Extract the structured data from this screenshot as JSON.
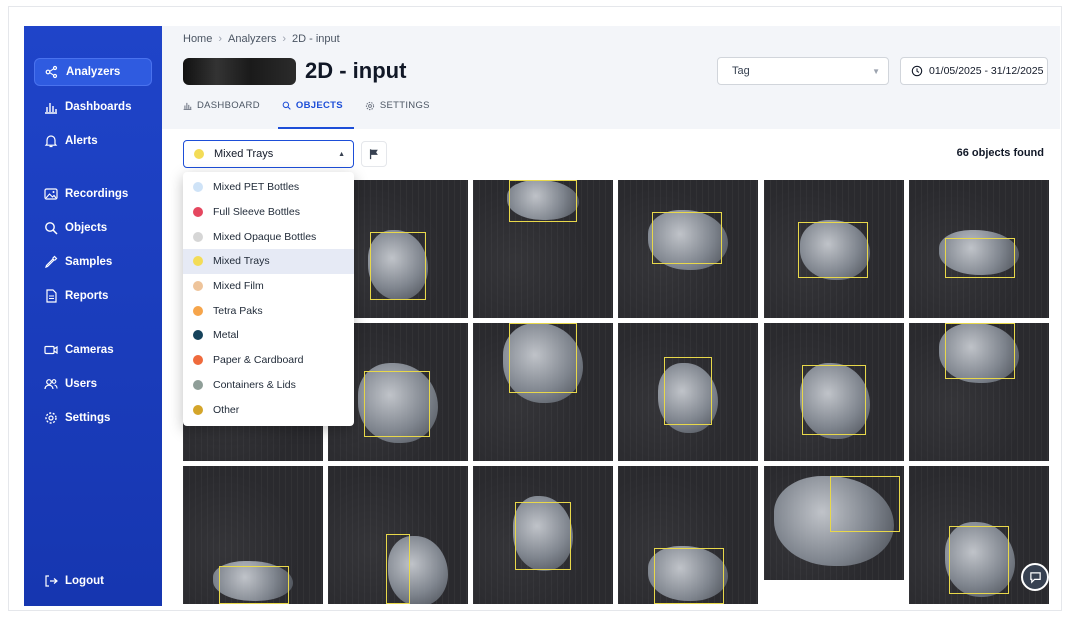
{
  "sidebar": {
    "items": [
      {
        "label": "Analyzers",
        "icon": "analyzers-icon",
        "active": true
      },
      {
        "label": "Dashboards",
        "icon": "bar-chart-icon"
      },
      {
        "label": "Alerts",
        "icon": "bell-icon"
      },
      {
        "label": "Recordings",
        "icon": "image-icon"
      },
      {
        "label": "Objects",
        "icon": "search-icon"
      },
      {
        "label": "Samples",
        "icon": "pipette-icon"
      },
      {
        "label": "Reports",
        "icon": "document-icon"
      },
      {
        "label": "Cameras",
        "icon": "camera-icon"
      },
      {
        "label": "Users",
        "icon": "users-icon"
      },
      {
        "label": "Settings",
        "icon": "gear-icon"
      }
    ],
    "logout_label": "Logout"
  },
  "breadcrumb": [
    "Home",
    "Analyzers",
    "2D - input"
  ],
  "page_title": "2D - input",
  "tabs": [
    {
      "label": "DASHBOARD",
      "icon": "bar-chart-icon"
    },
    {
      "label": "OBJECTS",
      "icon": "search-icon",
      "active": true
    },
    {
      "label": "SETTINGS",
      "icon": "gear-icon"
    }
  ],
  "tag_select": {
    "value": "Tag"
  },
  "date_range": "01/05/2025 - 31/12/2025",
  "filter": {
    "selected": "Mixed Trays",
    "selected_color": "#f3dc57"
  },
  "result_count": "66 objects found",
  "dropdown_options": [
    {
      "label": "Mixed PET Bottles",
      "color": "#cfe3f7"
    },
    {
      "label": "Full Sleeve Bottles",
      "color": "#e5475f"
    },
    {
      "label": "Mixed Opaque Bottles",
      "color": "#d6d6d6"
    },
    {
      "label": "Mixed Trays",
      "color": "#f3dc57",
      "selected": true
    },
    {
      "label": "Mixed Film",
      "color": "#eec49b"
    },
    {
      "label": "Tetra Paks",
      "color": "#f6a54b"
    },
    {
      "label": "Metal",
      "color": "#16425b"
    },
    {
      "label": "Paper & Cardboard",
      "color": "#ef6a3c"
    },
    {
      "label": "Containers & Lids",
      "color": "#8f9e98"
    },
    {
      "label": "Other",
      "color": "#d4a52a"
    }
  ],
  "colors": {
    "sidebar": "#1e40c4",
    "accent": "#1d4ed8",
    "bbox": "#e8d84a"
  }
}
